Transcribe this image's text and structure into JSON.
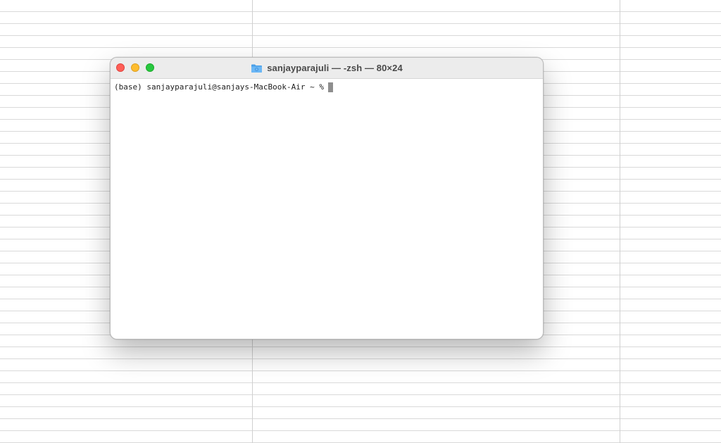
{
  "window": {
    "title": "sanjayparajuli — -zsh — 80×24",
    "folder_icon": "folder-icon"
  },
  "terminal": {
    "prompt": "(base) sanjayparajuli@sanjays-MacBook-Air ~ %"
  },
  "colors": {
    "close": "#ff5f57",
    "minimize": "#febc2e",
    "zoom": "#28c840",
    "folder": "#5aaef0"
  }
}
